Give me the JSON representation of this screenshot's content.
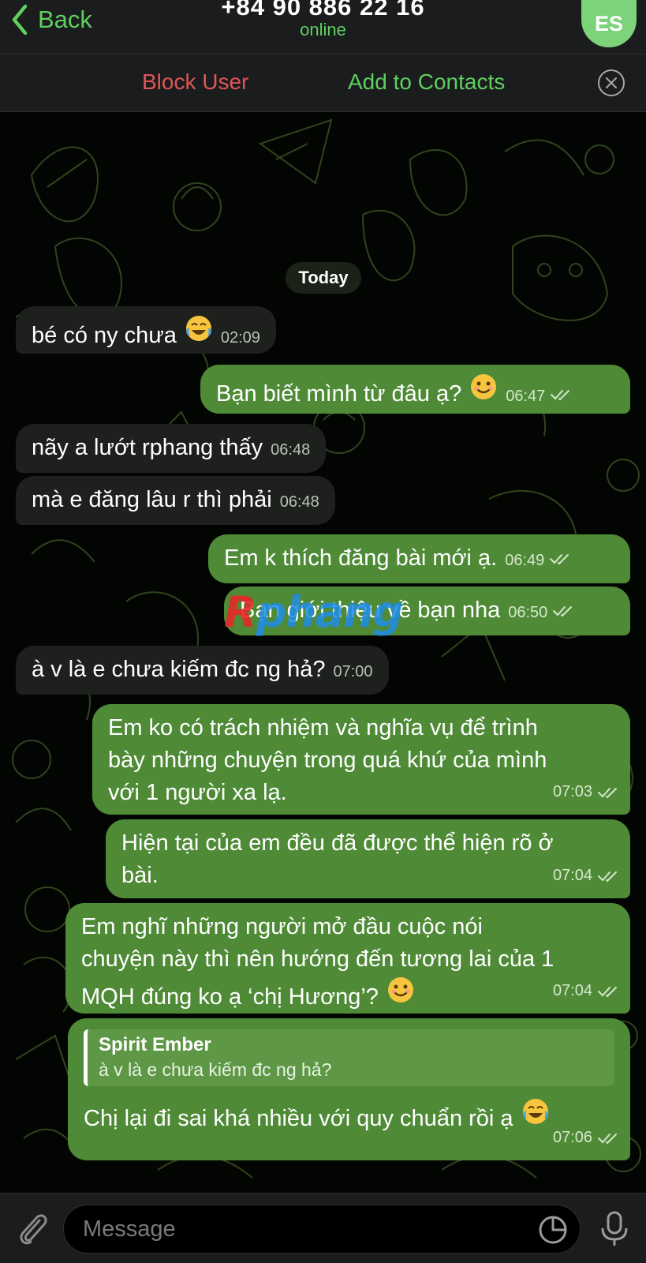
{
  "header": {
    "back_label": "Back",
    "title": "+84 90 886 22 16",
    "status": "online",
    "avatar_initials": "ES"
  },
  "actionbar": {
    "block_label": "Block User",
    "add_label": "Add to Contacts"
  },
  "chat": {
    "date_label": "Today",
    "messages": [
      {
        "dir": "in",
        "text": "bé có ny chưa",
        "emoji": "joy",
        "time": "02:09"
      },
      {
        "dir": "out",
        "text": "Bạn biết mình từ đâu ạ?",
        "emoji": "smile",
        "time": "06:47"
      },
      {
        "dir": "in",
        "text": "nãy a lướt rphang thấy",
        "time": "06:48"
      },
      {
        "dir": "in",
        "text": "mà e đăng lâu r thì phải",
        "time": "06:48"
      },
      {
        "dir": "out",
        "text": "Em k thích đăng bài mới ạ.",
        "time": "06:49"
      },
      {
        "dir": "out",
        "text": "Bạn giới thiệu về bạn nha",
        "time": "06:50"
      },
      {
        "dir": "in",
        "text": "à v là e chưa kiếm đc ng hả?",
        "time": "07:00"
      },
      {
        "dir": "out",
        "lines": [
          "Em ko có trách nhiệm và nghĩa vụ để trình",
          "bày những chuyện trong quá khứ của mình",
          "với 1 người xa lạ."
        ],
        "time": "07:03"
      },
      {
        "dir": "out",
        "lines": [
          "Hiện tại của em đều đã được thể hiện rõ ở",
          "bài."
        ],
        "time": "07:04"
      },
      {
        "dir": "out",
        "lines": [
          "Em nghĩ những người mở đầu cuộc nói",
          "chuyện này thì nên hướng đến tương lai của 1",
          "MQH đúng ko ạ ‘chị Hương’?"
        ],
        "emoji": "smile",
        "time": "07:04"
      },
      {
        "dir": "out",
        "reply_name": "Spirit Ember",
        "reply_text": "à v là e chưa kiếm đc ng hả?",
        "text": "Chị lại đi sai khá nhiều với quy chuẩn rồi ạ",
        "emoji": "joy",
        "time": "07:06"
      }
    ],
    "watermark": {
      "r": "R",
      "p": "phang"
    }
  },
  "input": {
    "placeholder": "Message"
  },
  "colors": {
    "accent_green": "#5fcf5f",
    "danger_red": "#e05555",
    "outgoing_bubble": "#4f8b37",
    "incoming_bubble": "#1e201e"
  },
  "icons": [
    "chevron-left-icon",
    "close-circle-icon",
    "paperclip-icon",
    "sticker-icon",
    "microphone-icon",
    "double-check-icon"
  ]
}
